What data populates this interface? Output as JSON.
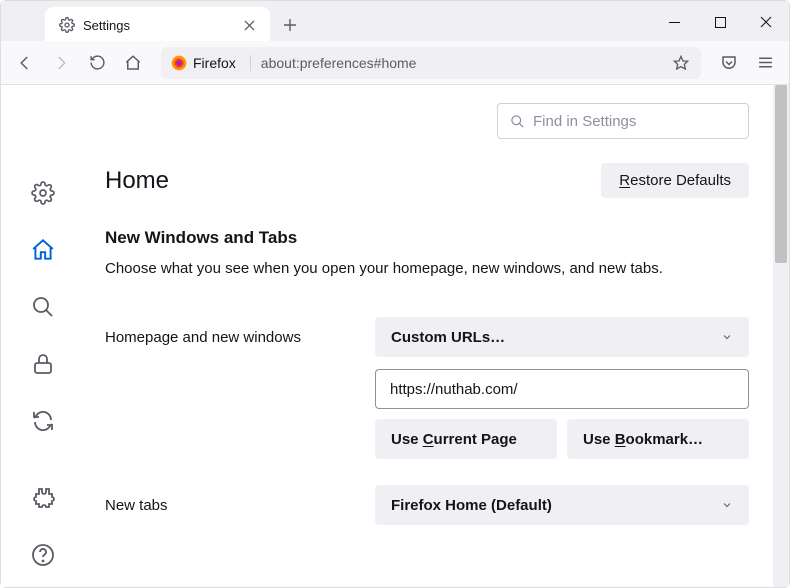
{
  "tab": {
    "label": "Settings"
  },
  "url": {
    "prefix": "Firefox",
    "addr": "about:preferences#home"
  },
  "search": {
    "placeholder": "Find in Settings"
  },
  "page": {
    "title": "Home",
    "restore_label": "Restore Defaults",
    "section_title": "New Windows and Tabs",
    "section_desc": "Choose what you see when you open your homepage, new windows, and new tabs."
  },
  "homepage": {
    "label": "Homepage and new windows",
    "select": "Custom URLs…",
    "url_value": "https://nuthab.com/",
    "use_current": "Use Current Page",
    "use_bookmark": "Use Bookmark…"
  },
  "newtabs": {
    "label": "New tabs",
    "select": "Firefox Home (Default)"
  }
}
